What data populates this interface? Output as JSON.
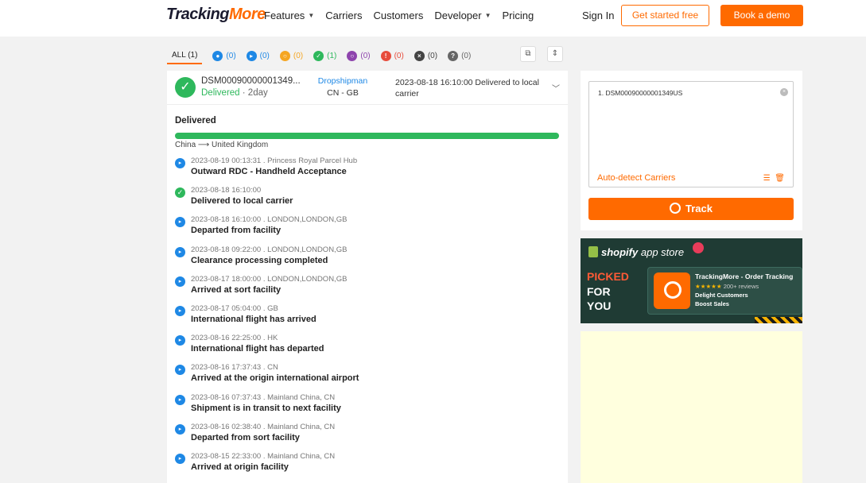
{
  "nav": {
    "logo_part1": "Tracking",
    "logo_part2": "More",
    "links": [
      {
        "label": "Features",
        "dropdown": true
      },
      {
        "label": "Carriers",
        "dropdown": false
      },
      {
        "label": "Customers",
        "dropdown": false
      },
      {
        "label": "Developer",
        "dropdown": true
      },
      {
        "label": "Pricing",
        "dropdown": false
      }
    ],
    "signin": "Sign In",
    "start": "Get started free",
    "demo": "Book a demo"
  },
  "filters": [
    {
      "label": "ALL (1)",
      "color": "",
      "icon": ""
    },
    {
      "label": "(0)",
      "color": "#1e88e5",
      "icon": "pending-icon",
      "glyph": "●"
    },
    {
      "label": "(0)",
      "color": "#1e88e5",
      "icon": "transit-icon",
      "glyph": "▸"
    },
    {
      "label": "(0)",
      "color": "#f5a623",
      "icon": "pickup-icon",
      "glyph": "○"
    },
    {
      "label": "(1)",
      "color": "#2eb85c",
      "icon": "delivered-icon",
      "glyph": "✓"
    },
    {
      "label": "(0)",
      "color": "#8e44ad",
      "icon": "undelivered-icon",
      "glyph": "○"
    },
    {
      "label": "(0)",
      "color": "#e74c3c",
      "icon": "exception-icon",
      "glyph": "!"
    },
    {
      "label": "(0)",
      "color": "#444444",
      "icon": "expired-icon",
      "glyph": "×"
    },
    {
      "label": "(0)",
      "color": "#666666",
      "icon": "notfound-icon",
      "glyph": "?"
    }
  ],
  "shipment": {
    "tracking_number": "DSM00090000001349...",
    "status": "Delivered",
    "age": " · 2day",
    "carrier": "Dropshipman",
    "route": "CN - GB",
    "last_event": "2023-08-18 16:10:00 Delivered to local carrier",
    "section_title": "Delivered",
    "route_from": "China",
    "route_to": "United Kingdom",
    "progress_fraction": 1.0
  },
  "events": [
    {
      "meta": "2023-08-19 00:13:31  . Princess Royal Parcel Hub",
      "desc": "Outward RDC - Handheld Acceptance",
      "icon": "transit-icon"
    },
    {
      "meta": "2023-08-18 16:10:00",
      "desc": "Delivered to local carrier",
      "icon": "check-icon"
    },
    {
      "meta": "2023-08-18 16:10:00  . LONDON,LONDON,GB",
      "desc": "Departed from facility",
      "icon": "transit-icon"
    },
    {
      "meta": "2023-08-18 09:22:00  . LONDON,LONDON,GB",
      "desc": "Clearance processing completed",
      "icon": "transit-icon"
    },
    {
      "meta": "2023-08-17 18:00:00  . LONDON,LONDON,GB",
      "desc": "Arrived at sort facility",
      "icon": "transit-icon"
    },
    {
      "meta": "2023-08-17 05:04:00  . GB",
      "desc": "International flight has arrived",
      "icon": "transit-icon"
    },
    {
      "meta": "2023-08-16 22:25:00  . HK",
      "desc": "International flight has departed",
      "icon": "transit-icon"
    },
    {
      "meta": "2023-08-16 17:37:43  . CN",
      "desc": "Arrived at the origin international airport",
      "icon": "transit-icon"
    },
    {
      "meta": "2023-08-16 07:37:43  . Mainland China, CN",
      "desc": "Shipment is in transit to next facility",
      "icon": "transit-icon"
    },
    {
      "meta": "2023-08-16 02:38:40  . Mainland China, CN",
      "desc": "Departed from sort facility",
      "icon": "transit-icon"
    },
    {
      "meta": "2023-08-15 22:33:00  . Mainland China, CN",
      "desc": "Arrived at origin facility",
      "icon": "transit-icon"
    }
  ],
  "track_panel": {
    "input_value": "1.  DSM00090000001349US",
    "auto_detect": "Auto-detect Carriers",
    "track_label": "Track"
  },
  "ad": {
    "store_brand": "shopify",
    "store_suffix": "app store",
    "picked": "PICKED",
    "for": "FOR",
    "you": "YOU",
    "app_name": "TrackingMore - Order Tracking",
    "stars": "★★★★★",
    "reviews": "200+ reviews",
    "line1": "Delight Customers",
    "line2": "Boost Sales"
  },
  "colors": {
    "accent": "#ff6a00",
    "delivered": "#2eb85c",
    "link": "#1e88e5"
  }
}
